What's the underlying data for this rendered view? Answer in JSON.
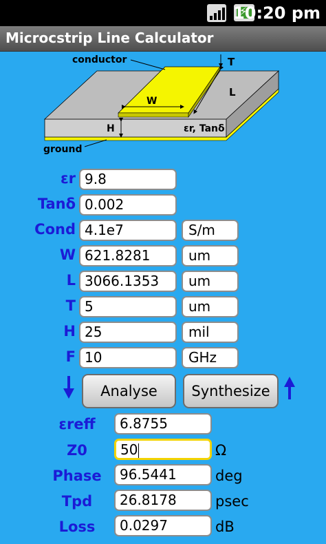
{
  "status_bar": {
    "time": "10:20 pm"
  },
  "app": {
    "title": "Microcstrip Line Calculator"
  },
  "diagram": {
    "conductor": "conductor",
    "ground": "ground",
    "T": "T",
    "W": "W",
    "L": "L",
    "H": "H",
    "er_tand": "εr, Tanδ"
  },
  "inputs": {
    "er": {
      "label": "εr",
      "value": "9.8"
    },
    "tand": {
      "label": "Tanδ",
      "value": "0.002"
    },
    "cond": {
      "label": "Cond",
      "value": "4.1e7",
      "unit": "S/m"
    },
    "w": {
      "label": "W",
      "value": "621.8281",
      "unit": "um"
    },
    "l": {
      "label": "L",
      "value": "3066.1353",
      "unit": "um"
    },
    "t": {
      "label": "T",
      "value": "5",
      "unit": "um"
    },
    "h": {
      "label": "H",
      "value": "25",
      "unit": "mil"
    },
    "f": {
      "label": "F",
      "value": "10",
      "unit": "GHz"
    }
  },
  "buttons": {
    "analyse": "Analyse",
    "synthesize": "Synthesize"
  },
  "outputs": {
    "ereff": {
      "label": "εreff",
      "value": "6.8755",
      "unit": ""
    },
    "z0": {
      "label": "Z0",
      "value": "50",
      "unit": "Ω"
    },
    "phase": {
      "label": "Phase",
      "value": "96.5441",
      "unit": "deg"
    },
    "tpd": {
      "label": "Tpd",
      "value": "26.8178",
      "unit": "psec"
    },
    "loss": {
      "label": "Loss",
      "value": "0.0297",
      "unit": "dB"
    }
  },
  "colors": {
    "background": "#29a9f0",
    "label": "#1b1bd6",
    "conductor": "#f5f500",
    "focus": "#f4d300"
  }
}
